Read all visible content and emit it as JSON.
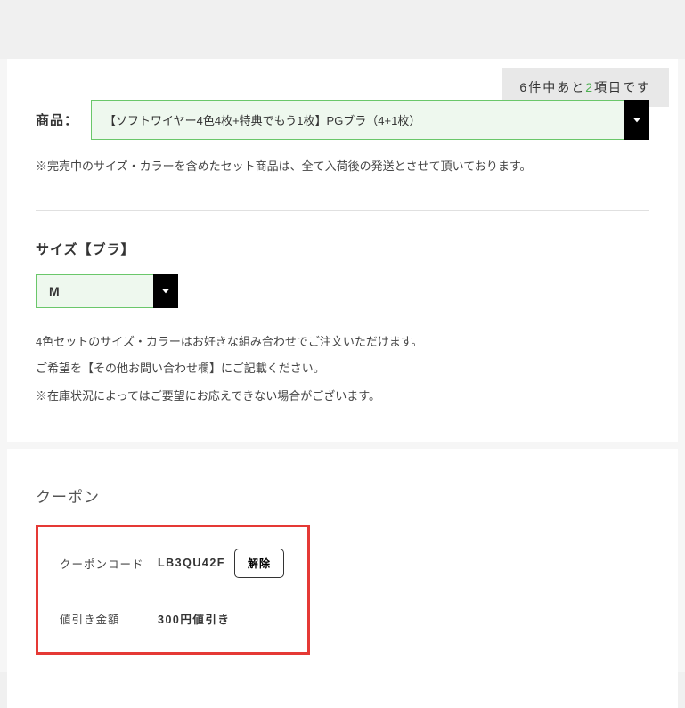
{
  "status": {
    "prefix": "6件中あと",
    "count": "2",
    "suffix": "項目です"
  },
  "product": {
    "label": "商品：",
    "selected": "【ソフトワイヤー4色4枚+特典でもう1枚】PGブラ（4+1枚）",
    "note": "※完売中のサイズ・カラーを含めたセット商品は、全て入荷後の発送とさせて頂いております。"
  },
  "size": {
    "title": "サイズ【ブラ】",
    "selected": "M",
    "note1": "4色セットのサイズ・カラーはお好きな組み合わせでご注文いただけます。",
    "note2": "ご希望を【その他お問い合わせ欄】にご記載ください。",
    "note3": "※在庫状況によってはご要望にお応えできない場合がございます。"
  },
  "coupon": {
    "title": "クーポン",
    "code_label": "クーポンコード",
    "code_value": "LB3QU42F",
    "release_label": "解除",
    "discount_label": "値引き金額",
    "discount_value": "300円値引き"
  }
}
